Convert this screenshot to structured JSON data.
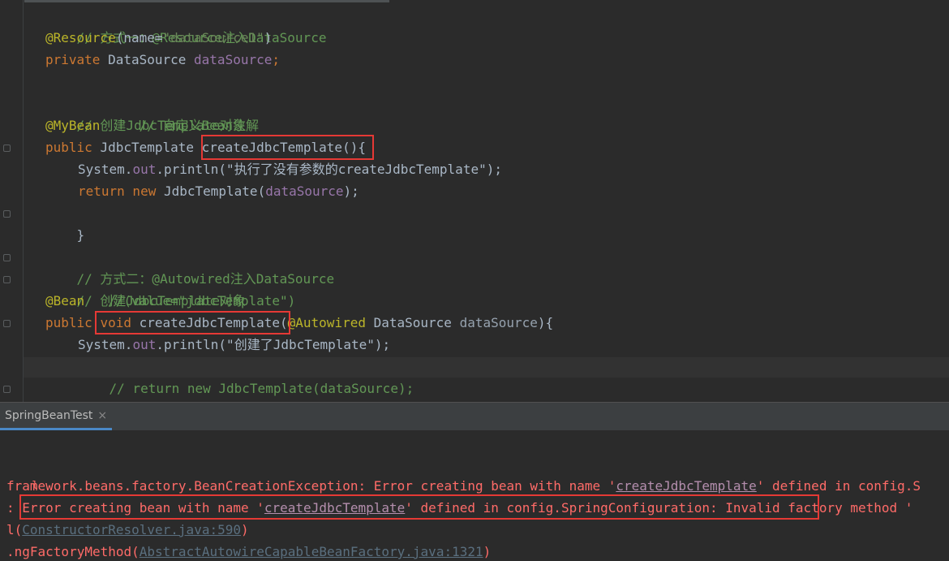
{
  "editor": {
    "lines": {
      "l1": "// 方式一：@Resource注入DataSource",
      "l2_ann": "@Resource",
      "l2_paren_open": "(",
      "l2_key": "name=",
      "l2_str": "\"dataSource1\"",
      "l2_paren_close": ")",
      "l3_kw": "private ",
      "l3_type": "DataSource ",
      "l3_field": "dataSource",
      "l3_semi": ";",
      "l5": "// 创建JdbcTemplate对象",
      "l6_ann": "@MyBean",
      "l6_cmt": "     // 自定义Bean注解",
      "l7_kw": "public ",
      "l7_type": "JdbcTemplate ",
      "l7_meth": "createJdbcTemplate",
      "l7_rest": "(){",
      "l8_sys": "System.",
      "l8_out": "out",
      "l8_dot": ".",
      "l8_println": "println",
      "l8_str": "(\"执行了没有参数的createJdbcTemplate\");",
      "l9_kw": "return new ",
      "l9_type": "JdbcTemplate(",
      "l9_field": "dataSource",
      "l9_end": ");",
      "l10": "}",
      "l12": "// 方式二：@Autowired注入DataSource",
      "l13": "// 创建JdbcTemplate对象",
      "l14_ann": "@Bean",
      "l14_cmt": "   //(value=\"jdbcTemplate\")",
      "l15_kw": "public ",
      "l15_void": "void ",
      "l15_meth": "createJdbcTemplate",
      "l15_paren": "(",
      "l15_ann": "@Autowired ",
      "l15_type": "DataSource ",
      "l15_param": "dataSource",
      "l15_end": "){",
      "l16_sys": "System.",
      "l16_out": "out",
      "l16_dot": ".",
      "l16_println": "println",
      "l16_str": "(\"创建了JdbcTemplate\");",
      "l17": "// return new JdbcTemplate(dataSource);",
      "l18": "}"
    }
  },
  "run_panel": {
    "tab_label": "SpringBeanTest",
    "tab_close": "×"
  },
  "console": {
    "c0": "l",
    "c1_a": "framework.beans.factory.BeanCreationException: Error creating bean with name '",
    "c1_link": "createJdbcTemplate",
    "c1_b": "' defined in config.S",
    "c2_a": ": Error creating bean with name '",
    "c2_link": "createJdbcTemplate",
    "c2_b": "' defined in config.SpringConfiguration: Invalid factory method '",
    "c3_a": "l(",
    "c3_link": "ConstructorResolver.java:590",
    "c3_b": ")",
    "c4_a": ".ngFactoryMethod(",
    "c4_link": "AbstractAutowireCapableBeanFactory.java:1321",
    "c4_b": ")"
  }
}
